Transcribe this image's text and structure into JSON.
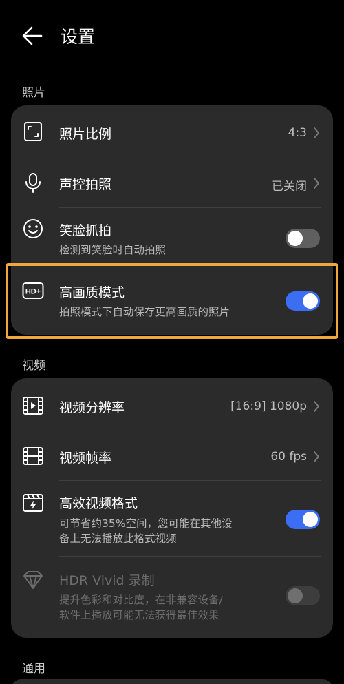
{
  "header": {
    "title": "设置"
  },
  "sections": {
    "photo": "照片",
    "video": "视频",
    "general": "通用"
  },
  "photo_items": {
    "ratio": {
      "label": "照片比例",
      "value": "4:3"
    },
    "voice": {
      "label": "声控拍照",
      "value": "已关闭"
    },
    "smile": {
      "label": "笑脸抓拍",
      "sub": "检测到笑脸时自动拍照",
      "on": false
    },
    "hd": {
      "label": "高画质模式",
      "sub": "拍照模式下自动保存更高画质的照片",
      "on": true,
      "icon_text": "HD+"
    }
  },
  "video_items": {
    "resolution": {
      "label": "视频分辨率",
      "value": "[16:9] 1080p"
    },
    "framerate": {
      "label": "视频帧率",
      "value": "60 fps"
    },
    "efficient": {
      "label": "高效视频格式",
      "sub_line1": "可节省约35%空间，您可能在其他设",
      "sub_line2": "备上无法播放此格式视频",
      "on": true
    },
    "hdr": {
      "label": "HDR Vivid 录制",
      "sub_line1": "提升色彩和对比度，在非兼容设备/",
      "sub_line2": "软件上播放可能无法获得最佳效果",
      "on": false,
      "disabled": true
    }
  },
  "colors": {
    "accent": "#3b6ef2",
    "highlight": "#f0a73c",
    "card": "#2b2b2b"
  }
}
